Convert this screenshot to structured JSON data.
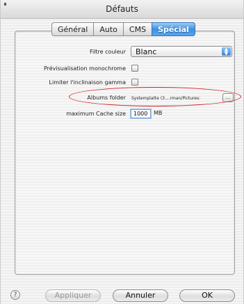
{
  "window": {
    "title": "Défauts"
  },
  "tabs": [
    {
      "label": "Général",
      "active": false
    },
    {
      "label": "Auto",
      "active": false
    },
    {
      "label": "CMS",
      "active": false
    },
    {
      "label": "Spécial",
      "active": true
    }
  ],
  "settings": {
    "filter_label": "Filtre couleur",
    "filter_value": "Blanc",
    "mono_preview_label": "Prévisualisation monochrome",
    "gamma_label": "Limiter l'inclinaison gamma",
    "albums_label": "Albums folder",
    "albums_path": "Systemplatte (3....rman/Pictures:",
    "browse_label": "...",
    "cache_label": "maximum Cache size",
    "cache_value": "1000",
    "cache_unit": "MB"
  },
  "buttons": {
    "help": "?",
    "apply": "Appliquer",
    "cancel": "Annuler",
    "ok": "OK"
  },
  "colors": {
    "active_tab": "#3f8fe0",
    "highlight_ellipse": "#d71f1f"
  }
}
